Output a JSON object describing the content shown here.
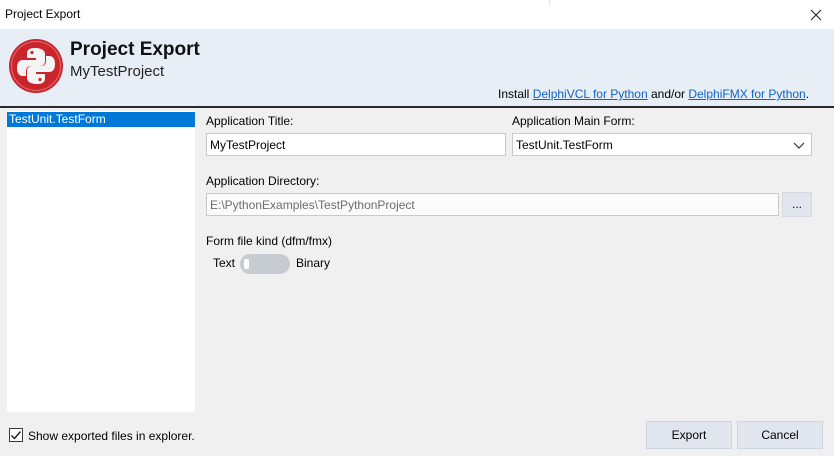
{
  "window": {
    "title": "Project Export"
  },
  "header": {
    "title": "Project Export",
    "subtitle": "MyTestProject",
    "install_prefix": "Install ",
    "link_vcl": "DelphiVCL for Python",
    "install_mid": " and/or ",
    "link_fmx": "DelphiFMX for Python",
    "install_suffix": "."
  },
  "form_list": {
    "items": [
      "TestUnit.TestForm"
    ],
    "selected_index": 0
  },
  "fields": {
    "app_title_label": "Application Title:",
    "app_title_value": "MyTestProject",
    "main_form_label": "Application Main Form:",
    "main_form_value": "TestUnit.TestForm",
    "app_dir_label": "Application Directory:",
    "app_dir_value": "E:\\PythonExamples\\TestPythonProject",
    "browse_label": "...",
    "form_kind_label": "Form file kind (dfm/fmx)",
    "toggle_left": "Text",
    "toggle_right": "Binary"
  },
  "footer": {
    "show_files_label": "Show exported files in explorer.",
    "show_files_checked": true,
    "export_label": "Export",
    "cancel_label": "Cancel"
  },
  "colors": {
    "accent": "#0078d7",
    "link": "#0f62c8",
    "header_bg": "#e8eef6",
    "logo_red": "#c8262c"
  },
  "icons": {
    "logo": "python-logo-icon",
    "close": "close-icon",
    "dropdown": "chevron-down-icon",
    "checkbox": "checkmark-icon"
  }
}
